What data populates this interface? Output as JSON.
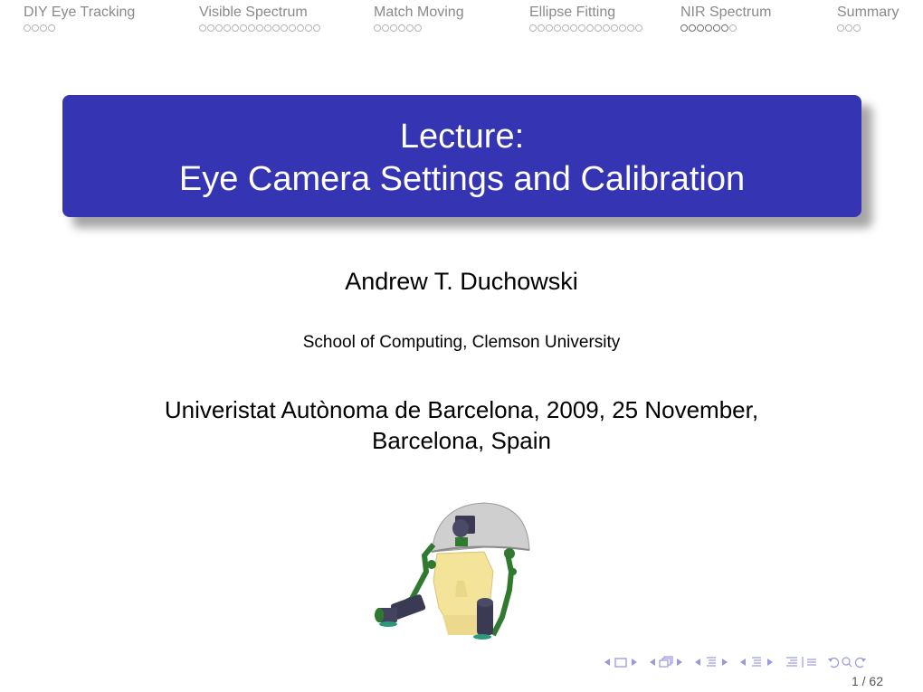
{
  "nav": {
    "sections": [
      {
        "title": "DIY Eye Tracking",
        "dots": 4,
        "current_dots": []
      },
      {
        "title": "Visible Spectrum",
        "dots": 15,
        "current_dots": []
      },
      {
        "title": "Match Moving",
        "dots": 6,
        "current_dots": []
      },
      {
        "title": "Ellipse Fitting",
        "dots": 14,
        "current_dots": []
      },
      {
        "title": "NIR Spectrum",
        "dots": 7,
        "current_dots": [
          0,
          1,
          2,
          3,
          4,
          5
        ]
      },
      {
        "title": "Summary",
        "dots": 3,
        "current_dots": []
      }
    ]
  },
  "title": {
    "line1": "Lecture:",
    "line2": "Eye Camera Settings and Calibration",
    "bg_color": "#3535b3"
  },
  "author": "Andrew T. Duchowski",
  "institute": "School of Computing, Clemson University",
  "date": {
    "line1": "Univeristat Autònoma de Barcelona, 2009, 25 November,",
    "line2": "Barcelona, Spain"
  },
  "figure": {
    "icon": "head-mounted-eye-tracker-illustration"
  },
  "footer": {
    "nav_icons": [
      "prev-arrow",
      "frame-icon",
      "next-arrow",
      "prev-arrow",
      "subsection-icon",
      "next-arrow",
      "prev-arrow",
      "section-icon",
      "next-arrow",
      "prev-arrow",
      "subsection-list-icon",
      "next-arrow",
      "document-icon",
      "list-icon",
      "back-icon",
      "search-icon",
      "forward-icon"
    ],
    "page": "1 / 62"
  }
}
